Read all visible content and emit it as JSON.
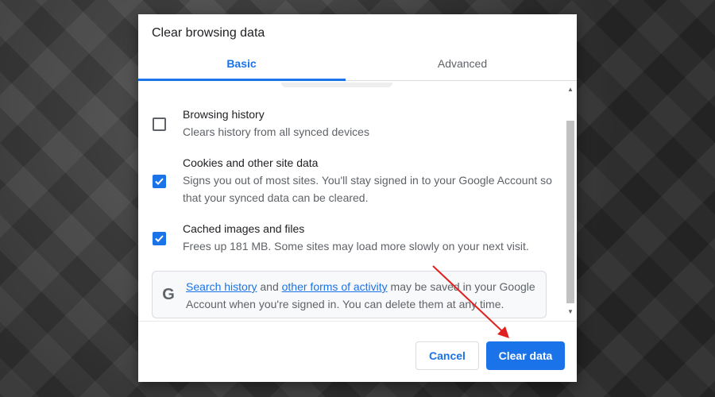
{
  "dialog": {
    "title": "Clear browsing data",
    "tabs": [
      {
        "label": "Basic",
        "active": true
      },
      {
        "label": "Advanced",
        "active": false
      }
    ],
    "items": [
      {
        "label": "Browsing history",
        "description": "Clears history from all synced devices",
        "checked": false
      },
      {
        "label": "Cookies and other site data",
        "description": "Signs you out of most sites. You'll stay signed in to your Google Account so that your synced data can be cleared.",
        "checked": true
      },
      {
        "label": "Cached images and files",
        "description": "Frees up 181 MB. Some sites may load more slowly on your next visit.",
        "checked": true
      }
    ],
    "info": {
      "icon": "google-g-icon",
      "icon_glyph": "G",
      "link1": "Search history",
      "text1": " and ",
      "link2": "other forms of activity",
      "text2": " may be saved in your Google Account when you're signed in. You can delete them at any time."
    },
    "buttons": {
      "cancel": "Cancel",
      "clear": "Clear data"
    }
  },
  "colors": {
    "accent": "#1a73e8",
    "annotation_arrow": "#e02020"
  }
}
